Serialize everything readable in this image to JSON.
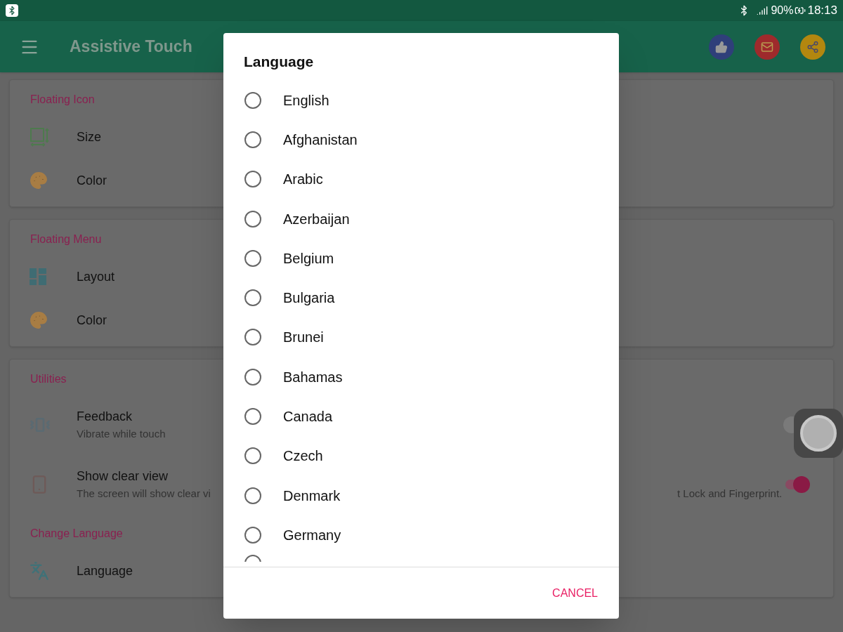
{
  "status_bar": {
    "battery": "90%",
    "time": "18:13"
  },
  "app_bar": {
    "title": "Assistive Touch"
  },
  "sections": [
    {
      "title": "Floating Icon",
      "items": [
        {
          "label": "Size",
          "kind": "plain"
        },
        {
          "label": "Color",
          "kind": "plain"
        }
      ]
    },
    {
      "title": "Floating Menu",
      "items": [
        {
          "label": "Layout",
          "kind": "plain"
        },
        {
          "label": "Color",
          "kind": "plain"
        }
      ]
    },
    {
      "title": "Utilities",
      "items": [
        {
          "label": "Feedback",
          "subtitle": "Vibrate while touch",
          "kind": "toggle",
          "on": false
        },
        {
          "label": "Show clear view",
          "subtitle": "The screen will show clear vi",
          "subtitle_tail": "t Lock and Fingerprint.",
          "kind": "toggle",
          "on": true
        }
      ]
    },
    {
      "title": "Change Language",
      "items": [
        {
          "label": "Language",
          "kind": "plain"
        }
      ]
    }
  ],
  "dialog": {
    "title": "Language",
    "options": [
      {
        "label": "English",
        "selected": false
      },
      {
        "label": "Afghanistan",
        "selected": false
      },
      {
        "label": "Arabic",
        "selected": false
      },
      {
        "label": "Azerbaijan",
        "selected": false
      },
      {
        "label": "Belgium",
        "selected": false
      },
      {
        "label": "Bulgaria",
        "selected": false
      },
      {
        "label": "Brunei",
        "selected": false
      },
      {
        "label": "Bahamas",
        "selected": false
      },
      {
        "label": "Canada",
        "selected": false
      },
      {
        "label": "Czech",
        "selected": false
      },
      {
        "label": "Denmark",
        "selected": false
      },
      {
        "label": "Germany",
        "selected": false
      }
    ],
    "clipped_option": {
      "selected": false
    },
    "cancel": "CANCEL"
  }
}
